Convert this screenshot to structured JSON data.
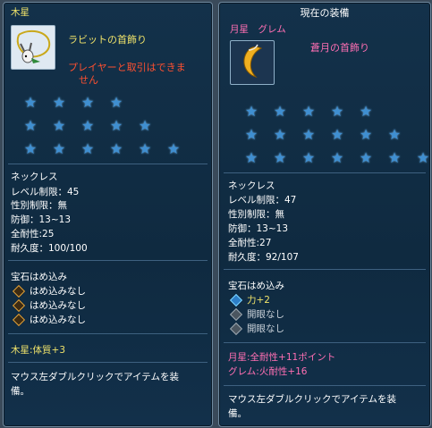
{
  "left": {
    "header": "木星",
    "item_name": "ラビットの首飾り",
    "warning_line1": "プレイヤーと取引はできま",
    "warning_line2": "せん",
    "item_type": "ネックレス",
    "stats": [
      "レベル制限：45",
      "性別制限：無",
      "防御：13~13",
      "全耐性:25",
      "耐久度：100/100"
    ],
    "gem_title": "宝石はめ込み",
    "gems": [
      "はめ込みなし",
      "はめ込みなし",
      "はめ込みなし"
    ],
    "bonus": "木星:体質+3",
    "footer_line1": "マウス左ダブルクリックでアイテムを装",
    "footer_line2": "備。",
    "stars_per_row": [
      4,
      5,
      6
    ]
  },
  "right": {
    "title": "現在の装備",
    "header": "月星　グレム",
    "item_name": "蒼月の首飾り",
    "item_type": "ネックレス",
    "stats": [
      "レベル制限：47",
      "性別制限：無",
      "防御：13~13",
      "全耐性:27",
      "耐久度：92/107"
    ],
    "gem_title": "宝石はめ込み",
    "gems": [
      "力+2",
      "開眼なし",
      "開眼なし"
    ],
    "bonus1": "月星:全耐性+11ポイント",
    "bonus2": "グレム:火耐性+16",
    "footer_line1": "マウス左ダブルクリックでアイテムを装",
    "footer_line2": "備。",
    "stars_per_row": [
      5,
      6,
      7
    ]
  },
  "colors": {
    "panel": "#12304a",
    "accent_yellow": "#f0e36a",
    "accent_pink": "#ff6fb3",
    "warning": "#ff5030",
    "star": "#3f8fd1"
  }
}
